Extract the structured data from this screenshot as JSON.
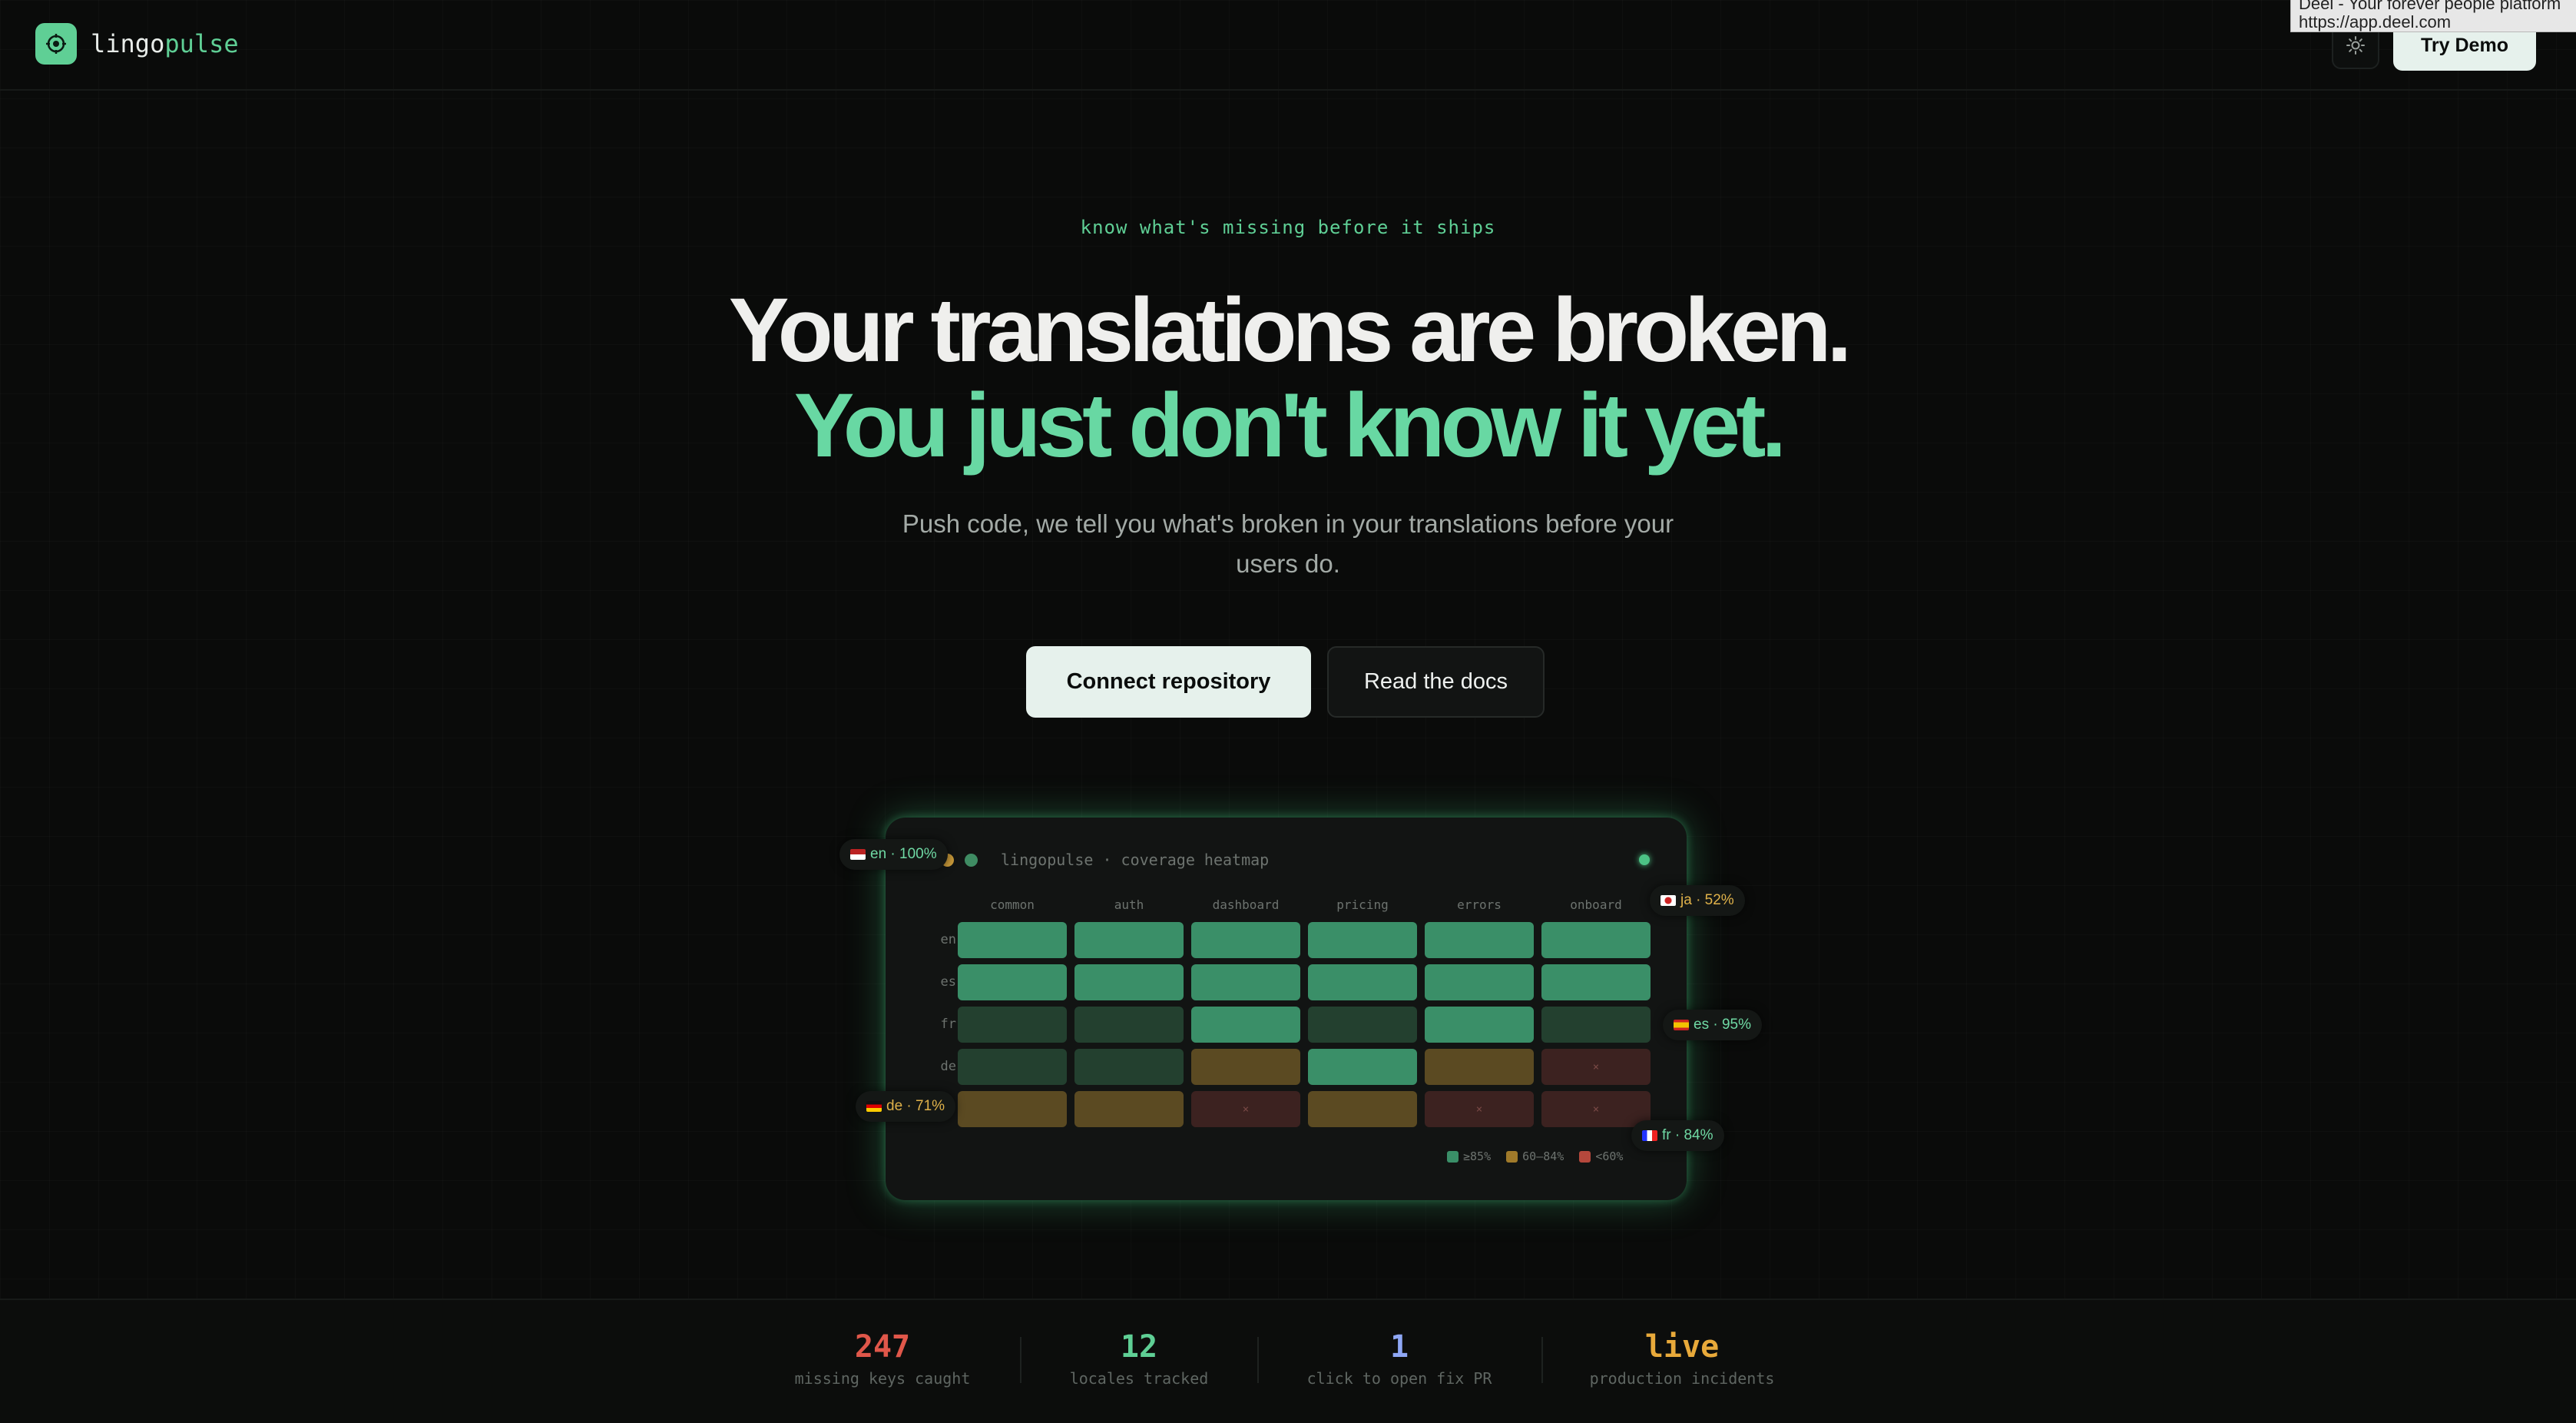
{
  "header": {
    "logo_part1": "lingo",
    "logo_part2": "pulse",
    "theme_icon": "sun-icon",
    "try_demo_label": "Try Demo"
  },
  "tooltip": {
    "line1": "Deel - Your forever people platform",
    "line2": "https://app.deel.com"
  },
  "hero": {
    "tagline": "know what's missing before it ships",
    "headline_line1": "Your translations are broken.",
    "headline_line2": "You just don't know it yet.",
    "subtext": "Push code, we tell you what's broken in your translations before your users do.",
    "primary_button": "Connect repository",
    "secondary_button": "Read the docs"
  },
  "heatmap": {
    "title": "lingopulse · coverage heatmap",
    "columns": [
      "common",
      "auth",
      "dashboard",
      "pricing",
      "errors",
      "onboard"
    ],
    "rows": [
      {
        "label": "en",
        "cells": [
          "high",
          "high",
          "high",
          "high",
          "high",
          "high"
        ]
      },
      {
        "label": "es",
        "cells": [
          "high",
          "high",
          "high",
          "high",
          "high",
          "high"
        ]
      },
      {
        "label": "fr",
        "cells": [
          "dim",
          "dim",
          "high",
          "dim",
          "high",
          "dim"
        ]
      },
      {
        "label": "de",
        "cells": [
          "dim",
          "dim",
          "mid",
          "high",
          "mid",
          "low"
        ]
      },
      {
        "label": "",
        "cells": [
          "mid",
          "mid",
          "low",
          "mid",
          "low",
          "low"
        ]
      }
    ],
    "low_mark": "×",
    "legend": [
      {
        "label": "≥85%",
        "color": "#3a8f68"
      },
      {
        "label": "60–84%",
        "color": "#a07a2a"
      },
      {
        "label": "<60%",
        "color": "#b5483c"
      }
    ],
    "pills": {
      "en": "en · 100%",
      "ja": "ja · 52%",
      "es": "es · 95%",
      "de": "de · 71%",
      "fr": "fr · 84%"
    },
    "colors": {
      "high": "#3a8f68",
      "dim": "#23402f",
      "mid": "#5b4a22",
      "low": "#3c2220",
      "pill_green": "#6fd9a4",
      "pill_amber": "#e0b24a"
    }
  },
  "stats": [
    {
      "value": "247",
      "label": "missing keys caught",
      "color": "#e0574a"
    },
    {
      "value": "12",
      "label": "locales tracked",
      "color": "#5fcf95"
    },
    {
      "value": "1",
      "label": "click to open fix PR",
      "color": "#8fa7f5"
    },
    {
      "value": "live",
      "label": "production incidents",
      "color": "#e8a93a"
    }
  ]
}
